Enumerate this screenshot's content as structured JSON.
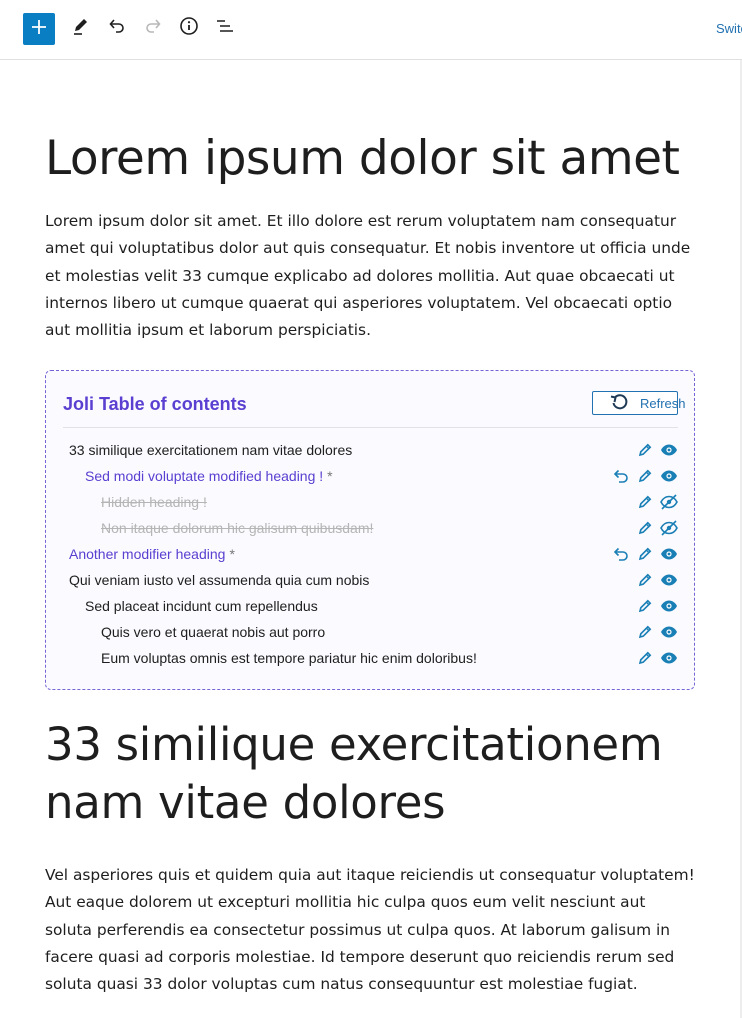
{
  "toolbar": {
    "add_icon": "plus-icon",
    "tools_icon": "pencil-icon",
    "undo_icon": "undo-icon",
    "redo_icon": "redo-icon",
    "info_icon": "info-icon",
    "list_view_icon": "list-view-icon",
    "switch_label": "Switch to draft"
  },
  "post": {
    "title": "Lorem ipsum dolor sit amet",
    "paragraph1": "Lorem ipsum dolor sit amet. Et illo dolore est rerum voluptatem nam consequatur amet qui voluptatibus dolor aut quis consequatur. Et nobis inventore ut officia unde et molestias velit 33 cumque explicabo ad dolores mollitia. Aut quae obcaecati ut internos libero ut cumque quaerat qui asperiores voluptatem. Vel obcaecati optio aut mollitia ipsum et laborum perspiciatis.",
    "heading2": "33 similique exercitationem nam vitae dolores",
    "paragraph2": "Vel asperiores quis et quidem quia aut itaque reiciendis ut consequatur voluptatem! Aut eaque dolorem ut excepturi mollitia hic culpa quos eum velit nesciunt aut soluta perferendis ea consectetur possimus ut culpa quos. At laborum galisum in facere quasi ad corporis molestiae. Id tempore deserunt quo reiciendis rerum sed soluta quasi 33 dolor voluptas cum natus consequuntur est molestiae fugiat."
  },
  "toc": {
    "title": "Joli Table of contents",
    "refresh_label": "Refresh",
    "accent_color": "#5a3fd1",
    "icon_color": "#1a7fb5",
    "items": [
      {
        "label": "33 similique exercitationem nam vitae dolores",
        "level": 0,
        "state": "normal",
        "modified_mark": ""
      },
      {
        "label": "Sed modi voluptate modified heading !",
        "level": 1,
        "state": "modified",
        "modified_mark": "*"
      },
      {
        "label": "Hidden heading !",
        "level": 2,
        "state": "hidden",
        "modified_mark": ""
      },
      {
        "label": "Non itaque dolorum hic galisum quibusdam!",
        "level": 2,
        "state": "hidden",
        "modified_mark": ""
      },
      {
        "label": "Another modifier heading",
        "level": 0,
        "state": "modified",
        "modified_mark": "*"
      },
      {
        "label": "Qui veniam iusto vel assumenda quia cum nobis",
        "level": 0,
        "state": "normal",
        "modified_mark": ""
      },
      {
        "label": "Sed placeat incidunt cum repellendus",
        "level": 1,
        "state": "normal",
        "modified_mark": ""
      },
      {
        "label": "Quis vero et quaerat nobis aut porro",
        "level": 2,
        "state": "normal",
        "modified_mark": ""
      },
      {
        "label": "Eum voluptas omnis est tempore pariatur hic enim doloribus!",
        "level": 2,
        "state": "normal",
        "modified_mark": ""
      }
    ]
  }
}
